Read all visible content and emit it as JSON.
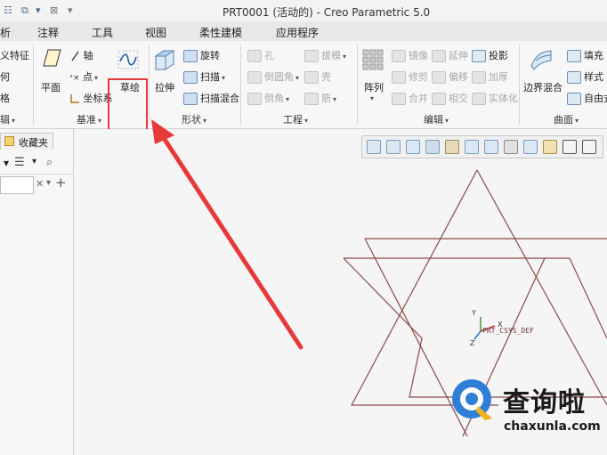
{
  "window": {
    "title": "PRT0001 (活动的) - Creo Parametric 5.0"
  },
  "tabs": [
    "析",
    "注释",
    "工具",
    "视图",
    "柔性建模",
    "应用程序"
  ],
  "ribbon": {
    "left_partial": {
      "top": "义特征",
      "mid": "何",
      "bot": "格",
      "label": "辑"
    },
    "datum": {
      "plane": "平面",
      "axis": "轴",
      "point": "点",
      "csys": "坐标系",
      "sketch": "草绘",
      "label": "基准"
    },
    "shapes": {
      "extrude": "拉伸",
      "revolve": "旋转",
      "sweep": "扫描",
      "swept_blend": "扫描混合",
      "label": "形状"
    },
    "engineering": {
      "hole": "孔",
      "round": "倒圆角",
      "chamfer": "倒角",
      "draft": "拔模",
      "shell": "壳",
      "rib": "筋",
      "label": "工程"
    },
    "editing": {
      "pattern": "阵列",
      "mirror": "镜像",
      "trim": "修剪",
      "merge": "合并",
      "extend": "延伸",
      "offset": "偏移",
      "intersect": "相交",
      "project": "投影",
      "thicken": "加厚",
      "solidify": "实体化",
      "label": "编辑"
    },
    "surfaces": {
      "boundary_blend": "边界混合",
      "fill": "填充",
      "style": "样式",
      "freestyle": "自由式",
      "label": "曲面"
    }
  },
  "left_panel": {
    "favorites_tab": "收藏夹"
  },
  "graphics": {
    "csys_label": "PRT_CSYS_DEF",
    "axis_x": "X",
    "axis_y": "Y",
    "axis_z": "Z"
  },
  "watermark": {
    "text": "查询啦",
    "url": "chaxunla.com"
  },
  "colors": {
    "highlight": "#e8393a",
    "sketch_lines": "#8a4a4a",
    "accent_blue": "#2f7fd6"
  }
}
